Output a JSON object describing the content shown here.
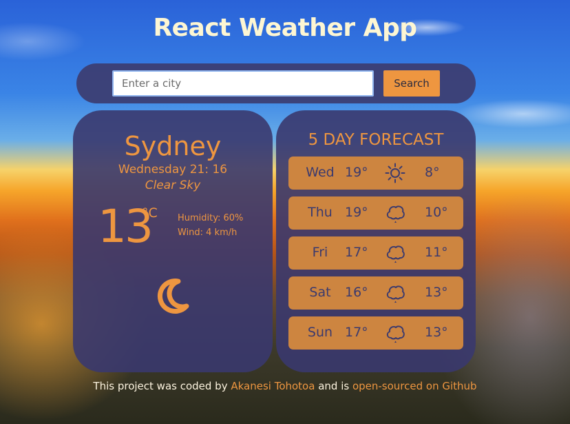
{
  "header": {
    "title": "React Weather App"
  },
  "search": {
    "placeholder": "Enter a city",
    "value": "",
    "button_label": "Search"
  },
  "current": {
    "city": "Sydney",
    "date_time": "Wednesday 21: 16",
    "description": "Clear Sky",
    "temperature": "13",
    "unit": "°C",
    "humidity": "Humidity: 60%",
    "wind": "Wind: 4 km/h",
    "icon": "moon-icon"
  },
  "forecast": {
    "title": "5 DAY FORECAST",
    "days": [
      {
        "day": "Wed",
        "high": "19°",
        "low": "8°",
        "icon": "sun-icon"
      },
      {
        "day": "Thu",
        "high": "19°",
        "low": "10°",
        "icon": "rain-cloud-icon"
      },
      {
        "day": "Fri",
        "high": "17°",
        "low": "11°",
        "icon": "rain-cloud-icon"
      },
      {
        "day": "Sat",
        "high": "16°",
        "low": "13°",
        "icon": "rain-cloud-icon"
      },
      {
        "day": "Sun",
        "high": "17°",
        "low": "13°",
        "icon": "rain-cloud-icon"
      }
    ]
  },
  "footer": {
    "prefix": "This project was coded by ",
    "author_link": "Akanesi Tohotoa",
    "middle": " and is ",
    "repo_link": "open-sourced on Github"
  },
  "colors": {
    "accent": "#ee9640",
    "card": "#3a386e",
    "row": "#cd8540",
    "title": "#fdf6d3"
  }
}
